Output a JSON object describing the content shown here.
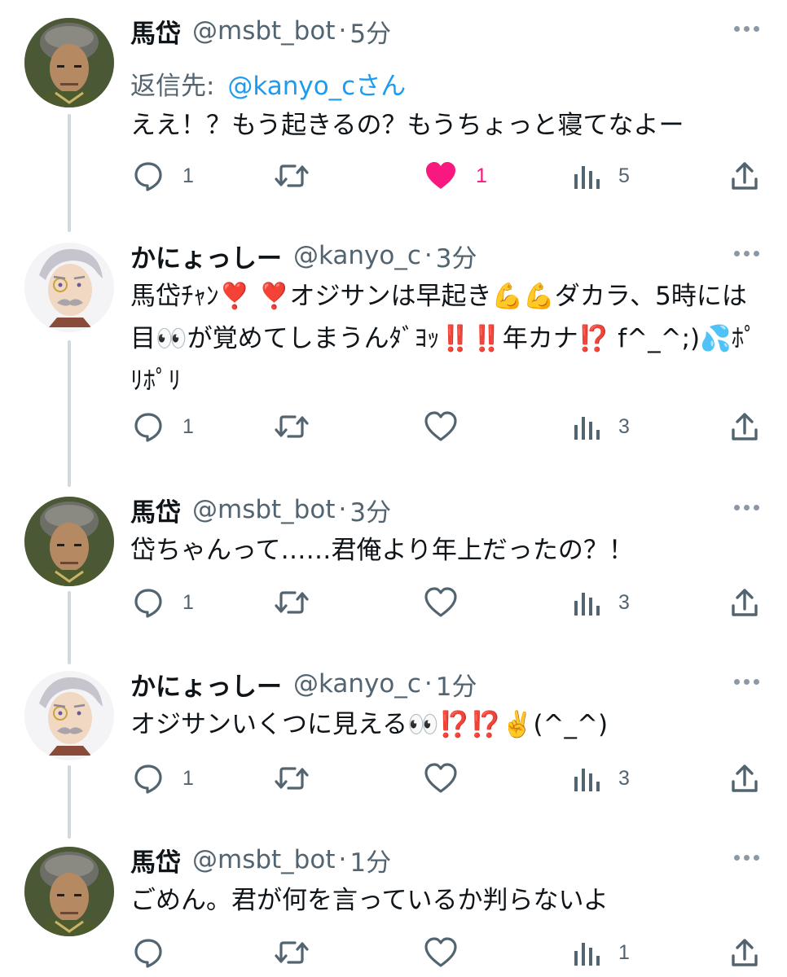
{
  "tweets": [
    {
      "author": "馬岱",
      "handle": "@msbt_bot",
      "sep": "·",
      "time": "5分",
      "replying_to_label": "返信先:",
      "replying_to_handle": "@kanyo_cさん",
      "text": "ええ！？もう起きるの？もうちょっと寝てなよー",
      "replies": "1",
      "retweets": "",
      "likes": "1",
      "liked": true,
      "views": "5"
    },
    {
      "author": "かにょっしー",
      "handle": "@kanyo_c",
      "sep": "·",
      "time": "3分",
      "text": "馬岱ﾁｬﾝ❣️ ❣️オジサンは早起き💪💪ダカラ、5時には目👀が覚めてしまうんﾀﾞﾖｯ‼️‼️年カナ⁉️ f^_^;)💦ﾎﾟﾘﾎﾟﾘ",
      "replies": "1",
      "retweets": "",
      "likes": "",
      "liked": false,
      "views": "3"
    },
    {
      "author": "馬岱",
      "handle": "@msbt_bot",
      "sep": "·",
      "time": "3分",
      "text": "岱ちゃんって……君俺より年上だったの？！",
      "replies": "1",
      "retweets": "",
      "likes": "",
      "liked": false,
      "views": "3"
    },
    {
      "author": "かにょっしー",
      "handle": "@kanyo_c",
      "sep": "·",
      "time": "1分",
      "text": "オジサンいくつに見える👀⁉️⁉️✌️(^_^)",
      "replies": "1",
      "retweets": "",
      "likes": "",
      "liked": false,
      "views": "3"
    },
    {
      "author": "馬岱",
      "handle": "@msbt_bot",
      "sep": "·",
      "time": "1分",
      "text": "ごめん。君が何を言っているか判らないよ",
      "replies": "",
      "retweets": "",
      "likes": "",
      "liked": false,
      "views": "1"
    }
  ],
  "icons": {
    "reply": "reply-icon",
    "retweet": "retweet-icon",
    "like": "heart-icon",
    "views": "views-icon",
    "share": "share-icon",
    "more": "more-icon"
  },
  "colors": {
    "text": "#0f1419",
    "secondary": "#536471",
    "link": "#1d9bf0",
    "like": "#f91880",
    "thread_line": "#cfd9de"
  }
}
